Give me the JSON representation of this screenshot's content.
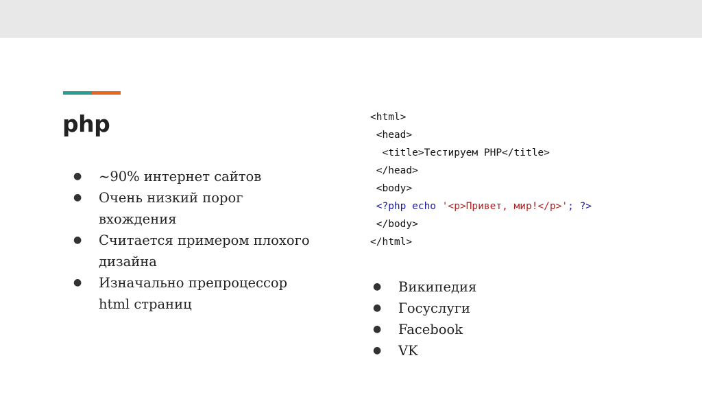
{
  "colors": {
    "accent_teal": "#2a9d8f",
    "accent_orange": "#e9651f",
    "php_keyword": "#1a1aa6",
    "php_string": "#b22222"
  },
  "slide": {
    "title": "php",
    "left_bullets": [
      "~90% интернет сайтов",
      "Очень низкий порог вхождения",
      "Считается примером плохого дизайна",
      "Изначально препроцессор html страниц"
    ],
    "right_bullets": [
      "Википедия",
      "Госуслуги",
      "Facebook",
      "VK"
    ],
    "bullet_glyph": "●",
    "code": {
      "l1": "<html>",
      "l2": " <head>",
      "l3": "  <title>Тестируем PHP</title>",
      "l4": " </head>",
      "l5": " <body>",
      "l6_open": " <?php",
      "l6_echo": " echo",
      "l6_str": " '<p>Привет, мир!</p>'",
      "l6_close": "; ?>",
      "l7": " </body>",
      "l8": "</html>"
    }
  }
}
